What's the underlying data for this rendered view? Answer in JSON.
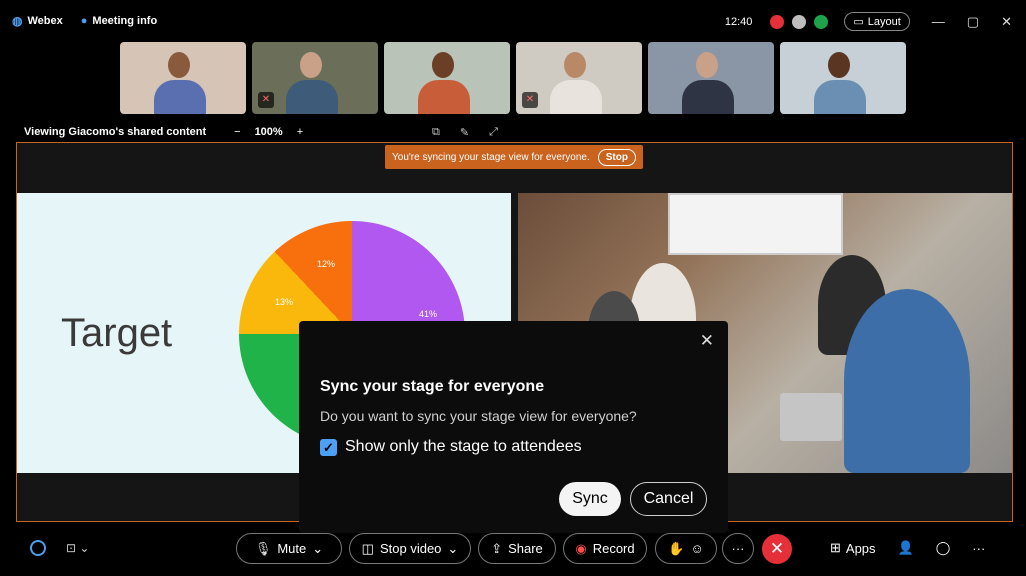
{
  "topbar": {
    "app": "Webex",
    "meeting_info": "Meeting info",
    "time": "12:40",
    "layout": "Layout",
    "indicators": [
      {
        "color": "#e5303a",
        "icon": "recording-icon"
      },
      {
        "color": "#bdbdbd",
        "icon": "lock-icon"
      },
      {
        "color": "#1fa34a",
        "icon": "network-icon"
      }
    ]
  },
  "participants": [
    {
      "bg": "#d6c5b6",
      "shirt": "#5a6fb0",
      "muted": false
    },
    {
      "bg": "#6b6f5a",
      "shirt": "#3e5c7a",
      "muted": true
    },
    {
      "bg": "#b9c3b8",
      "shirt": "#c85d3a",
      "muted": false
    },
    {
      "bg": "#d0cbc2",
      "shirt": "#e8e3dc",
      "muted": true
    },
    {
      "bg": "#8a95a5",
      "shirt": "#2e3444",
      "muted": false
    },
    {
      "bg": "#c6d0d6",
      "shirt": "#6b8eb3",
      "muted": false
    }
  ],
  "infobar": {
    "viewing": "Viewing Giacomo's shared content",
    "zoom_out": "−",
    "zoom": "100%",
    "zoom_in": "+"
  },
  "banner": {
    "text": "You're syncing your stage view for everyone.",
    "stop": "Stop"
  },
  "slide": {
    "title": "Target",
    "pie": [
      {
        "pct": "41%",
        "color": "#b158f0"
      },
      {
        "pct": "13%",
        "color": "#fbb80c"
      },
      {
        "pct": "12%",
        "color": "#f7700d"
      }
    ]
  },
  "dialog": {
    "title": "Sync your stage for everyone",
    "body": "Do you want to sync your stage view for everyone?",
    "checkbox": "Show only the stage to attendees",
    "checked": true,
    "sync": "Sync",
    "cancel": "Cancel"
  },
  "controls": {
    "mute": "Mute",
    "stop_video": "Stop video",
    "share": "Share",
    "record": "Record",
    "apps": "Apps"
  }
}
